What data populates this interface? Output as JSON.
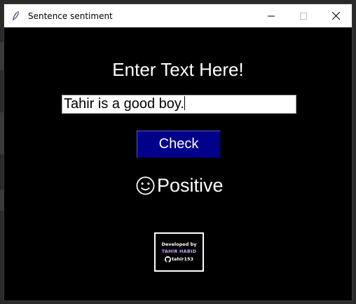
{
  "window": {
    "title": "Sentence sentiment",
    "icon": "feather-icon"
  },
  "controls": {
    "minimize_icon": "minimize-icon",
    "maximize_icon": "maximize-icon",
    "close_icon": "close-icon"
  },
  "main": {
    "heading": "Enter Text Here!",
    "input_value": "Tahir is a good boy.",
    "check_label": "Check",
    "result_icon": "smiley-icon",
    "result_text": "Positive"
  },
  "badge": {
    "line1": "Developed by",
    "line2": "TAHIR HABID",
    "line3": "tahir153",
    "github_icon": "github-icon"
  },
  "colors": {
    "background": "#000000",
    "button": "#00008b",
    "badge_name": "#c9a6ff"
  }
}
